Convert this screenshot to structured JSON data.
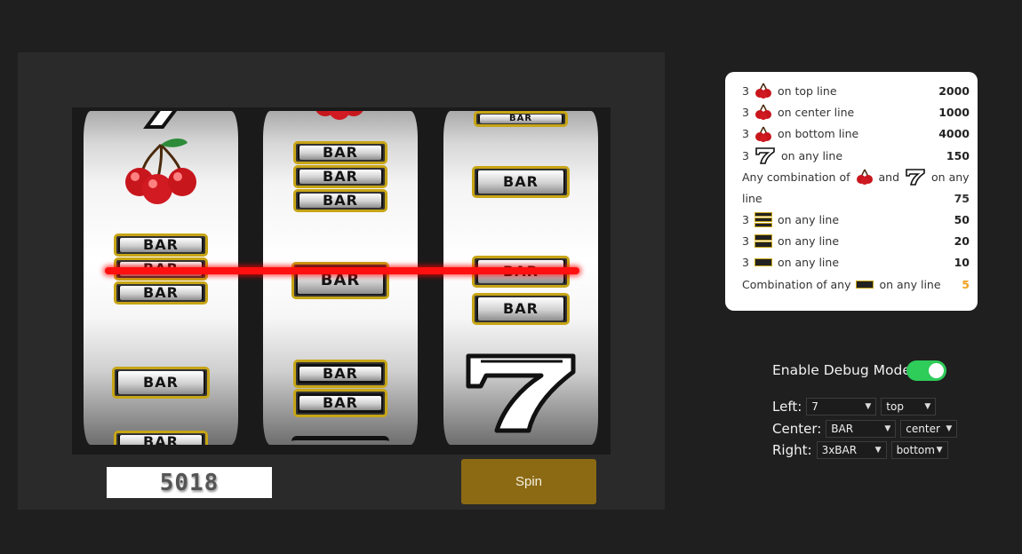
{
  "machine": {
    "credits": "5018",
    "spin_label": "Spin",
    "reels": {
      "left": [
        "seven",
        "cherry",
        "bar-1",
        "bar-1",
        "bar-1",
        "bar-1",
        "bar-2"
      ],
      "center": [
        "cherry",
        "3xbar",
        "bar-1",
        "2xbar"
      ],
      "right": [
        "bar-1",
        "bar-1",
        "bar-1",
        "bar-1",
        "seven"
      ]
    },
    "bar_text": "BAR"
  },
  "paytable": {
    "rows": [
      {
        "count": "3",
        "text": "on top line",
        "payout": "2000"
      },
      {
        "count": "3",
        "text": "on center line",
        "payout": "1000"
      },
      {
        "count": "3",
        "text": "on bottom line",
        "payout": "4000"
      },
      {
        "count": "3",
        "text": "on any line",
        "payout": "150"
      },
      {
        "text_a": "Any combination of",
        "text_b": "and",
        "text_c": "on any",
        "text_d": "line",
        "payout": "75"
      },
      {
        "count": "3",
        "text": "on any line",
        "payout": "50"
      },
      {
        "count": "3",
        "text": "on any line",
        "payout": "20"
      },
      {
        "count": "3",
        "text": "on any line",
        "payout": "10"
      },
      {
        "text_a": "Combination of any",
        "text": "on any line",
        "payout": "5"
      }
    ],
    "accent_color": "#f0a020"
  },
  "debug": {
    "label": "Enable Debug Mode:",
    "enabled": true,
    "left": {
      "label": "Left:",
      "symbol": "7",
      "position": "top"
    },
    "center": {
      "label": "Center:",
      "symbol": "BAR",
      "position": "center"
    },
    "right": {
      "label": "Right:",
      "symbol": "3xBAR",
      "position": "bottom"
    }
  }
}
